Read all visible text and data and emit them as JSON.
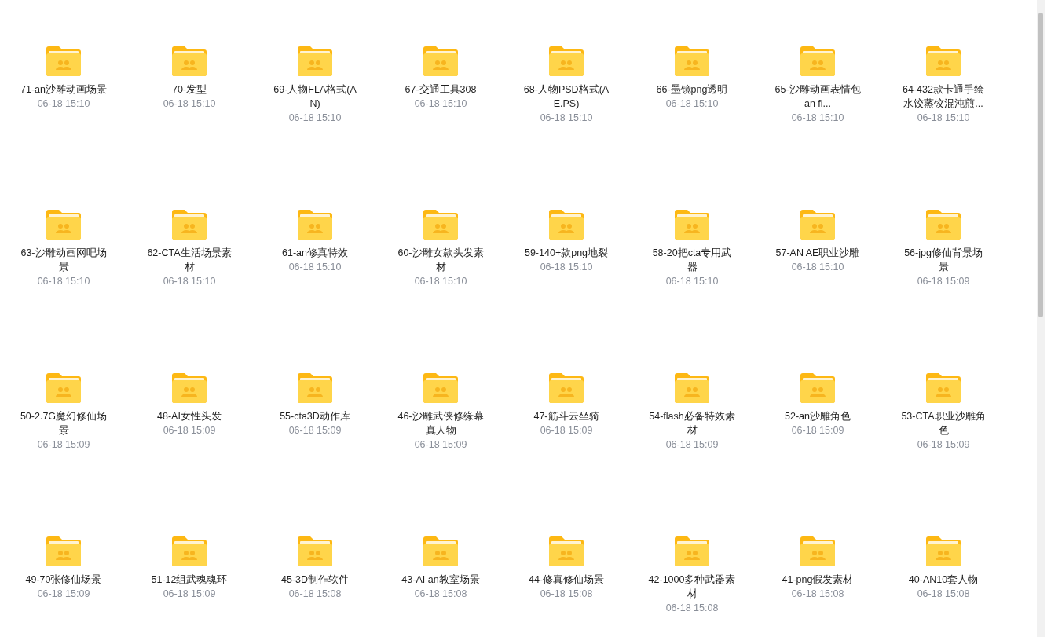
{
  "folders": [
    {
      "name": "71-an沙雕动画场景",
      "time": "06-18 15:10"
    },
    {
      "name": "70-发型",
      "time": "06-18 15:10"
    },
    {
      "name": "69-人物FLA格式(AN)",
      "time": "06-18 15:10"
    },
    {
      "name": "67-交通工具308",
      "time": "06-18 15:10"
    },
    {
      "name": "68-人物PSD格式(AE.PS)",
      "time": "06-18 15:10"
    },
    {
      "name": "66-墨镜png透明",
      "time": "06-18 15:10"
    },
    {
      "name": "65-沙雕动画表情包 an fl...",
      "time": "06-18 15:10"
    },
    {
      "name": "64-432款卡通手绘水饺蒸饺混沌煎...",
      "time": "06-18 15:10"
    },
    {
      "name": "63-沙雕动画网吧场景",
      "time": "06-18 15:10"
    },
    {
      "name": "62-CTA生活场景素材",
      "time": "06-18 15:10"
    },
    {
      "name": "61-an修真特效",
      "time": "06-18 15:10"
    },
    {
      "name": "60-沙雕女款头发素材",
      "time": "06-18 15:10"
    },
    {
      "name": "59-140+款png地裂",
      "time": "06-18 15:10"
    },
    {
      "name": "58-20把cta专用武器",
      "time": "06-18 15:10"
    },
    {
      "name": "57-AN AE职业沙雕",
      "time": "06-18 15:10"
    },
    {
      "name": "56-jpg修仙背景场景",
      "time": "06-18 15:09"
    },
    {
      "name": "50-2.7G魔幻修仙场景",
      "time": "06-18 15:09"
    },
    {
      "name": "48-AI女性头发",
      "time": "06-18 15:09"
    },
    {
      "name": "55-cta3D动作库",
      "time": "06-18 15:09"
    },
    {
      "name": "46-沙雕武侠修缘幕真人物",
      "time": "06-18 15:09"
    },
    {
      "name": "47-筋斗云坐骑",
      "time": "06-18 15:09"
    },
    {
      "name": "54-flash必备特效素材",
      "time": "06-18 15:09"
    },
    {
      "name": "52-an沙雕角色",
      "time": "06-18 15:09"
    },
    {
      "name": "53-CTA职业沙雕角色",
      "time": "06-18 15:09"
    },
    {
      "name": "49-70张修仙场景",
      "time": "06-18 15:09"
    },
    {
      "name": "51-12组武魂魂环",
      "time": "06-18 15:09"
    },
    {
      "name": "45-3D制作软件",
      "time": "06-18 15:08"
    },
    {
      "name": "43-AI an教室场景",
      "time": "06-18 15:08"
    },
    {
      "name": "44-修真修仙场景",
      "time": "06-18 15:08"
    },
    {
      "name": "42-1000多种武器素材",
      "time": "06-18 15:08"
    },
    {
      "name": "41-png假发素材",
      "time": "06-18 15:08"
    },
    {
      "name": "40-AN10套人物",
      "time": "06-18 15:08"
    }
  ]
}
